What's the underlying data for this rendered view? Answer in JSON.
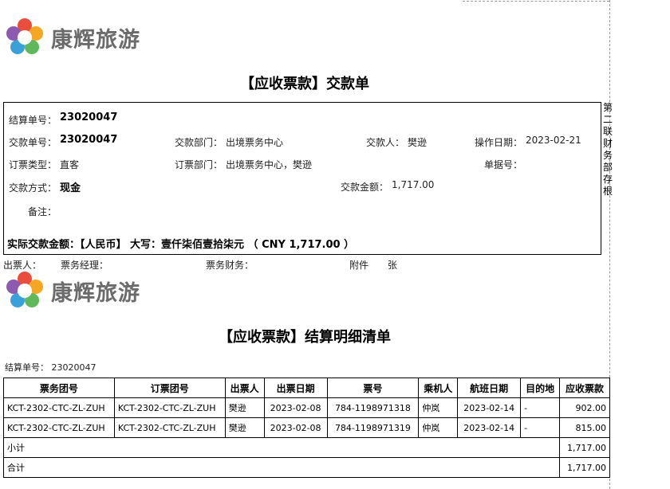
{
  "company": {
    "name": "康辉旅游"
  },
  "voucher": {
    "title": "【应收票款】交款单",
    "settle_no_label": "结算单号：",
    "settle_no": "23020047",
    "pay_no_label": "交款单号：",
    "pay_no": "23020047",
    "pay_dept_label": "交款部门：",
    "pay_dept": "出境票务中心",
    "payer_label": "交款人：",
    "payer": "樊逊",
    "op_date_label": "操作日期：",
    "op_date": "2023-02-21",
    "order_type_label": "订票类型：",
    "order_type": "直客",
    "order_dept_label": "订票部门：",
    "order_dept": "出境票务中心，樊逊",
    "doc_no_label": "单据号：",
    "doc_no": "",
    "pay_method_label": "交款方式：",
    "pay_method": "现金",
    "amount_label": "交款金额：",
    "amount": "1,717.00",
    "remark_label": "备注：",
    "remark": "",
    "actual_line": "实际交款金额：【人民币】 大写：壹仟柒佰壹拾柒元 （ CNY 1,717.00 ）",
    "side_note": "第二联财务部存根"
  },
  "signatures": {
    "issuer_label": "出票人：",
    "manager_label": "票务经理：",
    "finance_label": "票务财务：",
    "attach_label": "附件",
    "attach_unit": "张"
  },
  "detail": {
    "title": "【应收票款】结算明细清单",
    "settle_no_line": "结算单号： 23020047",
    "headers": [
      "票务团号",
      "订票团号",
      "出票人",
      "出票日期",
      "票号",
      "乘机人",
      "航班日期",
      "目的地",
      "应收票款"
    ],
    "rows": [
      [
        "KCT-2302-CTC-ZL-ZUH",
        "KCT-2302-CTC-ZL-ZUH",
        "樊逊",
        "2023-02-08",
        "784-1198971318",
        "仲岚",
        "2023-02-14",
        "-",
        "902.00"
      ],
      [
        "KCT-2302-CTC-ZL-ZUH",
        "KCT-2302-CTC-ZL-ZUH",
        "樊逊",
        "2023-02-08",
        "784-1198971319",
        "仲岚",
        "2023-02-14",
        "-",
        "815.00"
      ]
    ],
    "subtotal_label": "小计",
    "subtotal": "1,717.00",
    "total_label": "合计",
    "total": "1,717.00"
  }
}
